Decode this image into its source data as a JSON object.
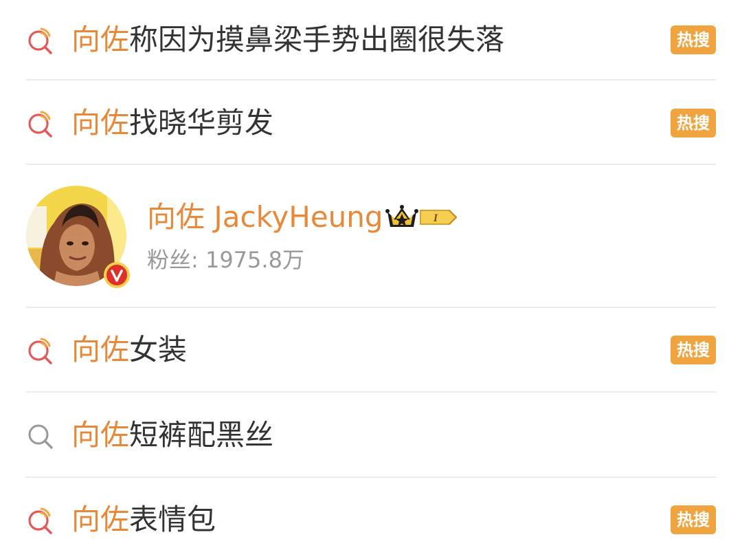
{
  "suggestions_top": [
    {
      "highlight": "向佐",
      "rest": "称因为摸鼻梁手势出圈很失落",
      "badge": "热搜",
      "icon": "hot-search-icon"
    },
    {
      "highlight": "向佐",
      "rest": "找晓华剪发",
      "badge": "热搜",
      "icon": "hot-search-icon"
    }
  ],
  "user_card": {
    "name": "向佐 JackyHeung",
    "fans_label": "粉丝: 1975.8万",
    "verified_icon": "verified-v-icon",
    "crown_icon": "crown-icon",
    "level_badge": "I",
    "colors": {
      "accent": "#e8893a",
      "verified": "#e0302a",
      "crown_gold": "#f2c130"
    }
  },
  "suggestions_bottom": [
    {
      "highlight": "向佐",
      "rest": "女装",
      "badge": "热搜",
      "icon": "hot-search-icon"
    },
    {
      "highlight": "向佐",
      "rest": "短裤配黑丝",
      "badge": "",
      "icon": "search-icon"
    },
    {
      "highlight": "向佐",
      "rest": "表情包",
      "badge": "热搜",
      "icon": "hot-search-icon"
    }
  ],
  "colors": {
    "highlight": "#e8893a",
    "text": "#333333",
    "badge_bg": "#f0a43f",
    "hot_icon_red": "#e25a5a",
    "hot_icon_orange": "#f2a93b",
    "plain_icon": "#999999"
  }
}
